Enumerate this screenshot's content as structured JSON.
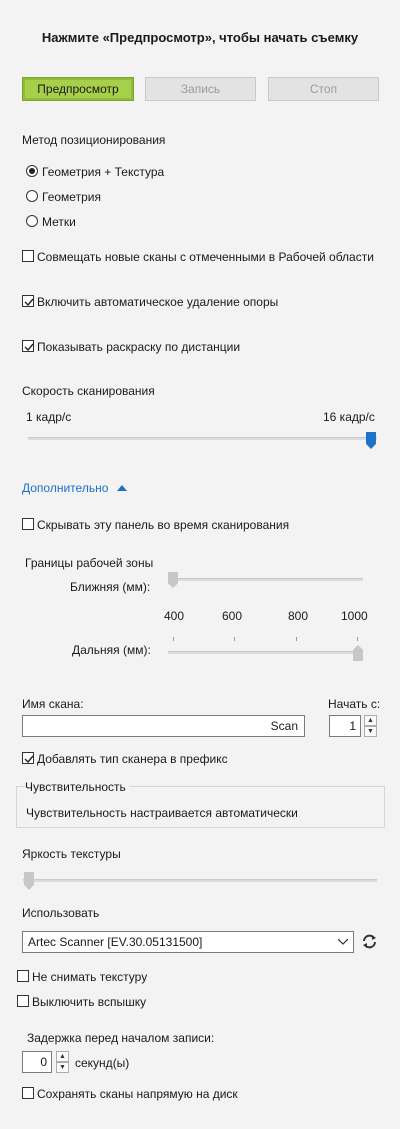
{
  "header": {
    "title": "Нажмите «Предпросмотр», чтобы начать съемку"
  },
  "toolbar": {
    "preview": "Предпросмотр",
    "record": "Запись",
    "stop": "Стоп"
  },
  "positioning": {
    "label": "Метод позиционирования",
    "options": [
      "Геометрия + Текстура",
      "Геометрия",
      "Метки"
    ],
    "selected": "Геометрия + Текстура"
  },
  "checks": {
    "align": {
      "label": "Совмещать новые сканы с отмеченными в Рабочей области",
      "checked": false
    },
    "base_removal": {
      "label": "Включить автоматическое удаление опоры",
      "checked": true
    },
    "distance_color": {
      "label": "Показывать раскраску по дистанции",
      "checked": true
    }
  },
  "scan_speed": {
    "label": "Скорость сканирования",
    "min_label": "1 кадр/с",
    "max_label": "16 кадр/с",
    "value": 16,
    "min": 1,
    "max": 16
  },
  "advanced": {
    "link": "Дополнительно",
    "hide_panel": {
      "label": "Скрывать эту панель во время сканирования",
      "checked": false
    },
    "zone": {
      "label": "Границы рабочей зоны",
      "near_label": "Ближняя (мм):",
      "far_label": "Дальняя (мм):",
      "ticks": [
        "400",
        "600",
        "800",
        "1000"
      ],
      "near_value": 400,
      "far_value": 1000
    }
  },
  "scan_name": {
    "label": "Имя скана:",
    "value": "Scan",
    "start_label": "Начать с:",
    "start_value": "1",
    "prefix": {
      "label": "Добавлять тип сканера в префикс",
      "checked": true
    }
  },
  "sensitivity": {
    "title": "Чувствительность",
    "text": "Чувствительность настраивается автоматически"
  },
  "texture_brightness": {
    "label": "Яркость текстуры",
    "value": 0
  },
  "use": {
    "label": "Использовать",
    "device": "Artec Scanner [EV.30.05131500]",
    "no_texture": {
      "label": "Не снимать текстуру",
      "checked": false
    },
    "no_flash": {
      "label": "Выключить вспышку",
      "checked": false
    }
  },
  "delay": {
    "label": "Задержка перед началом записи:",
    "value": "0",
    "unit": "секунд(ы)"
  },
  "save_to_disk": {
    "label": "Сохранять сканы напрямую на диск",
    "checked": false
  },
  "colors": {
    "accent": "#1e73c8",
    "preview_green": "#a6cf4a",
    "link": "#1e6ec8"
  },
  "icons": {
    "checkmark": "checkmark-icon",
    "refresh": "refresh-icon",
    "chevron_up": "chevron-up-icon",
    "dropdown": "chevron-down-icon"
  }
}
